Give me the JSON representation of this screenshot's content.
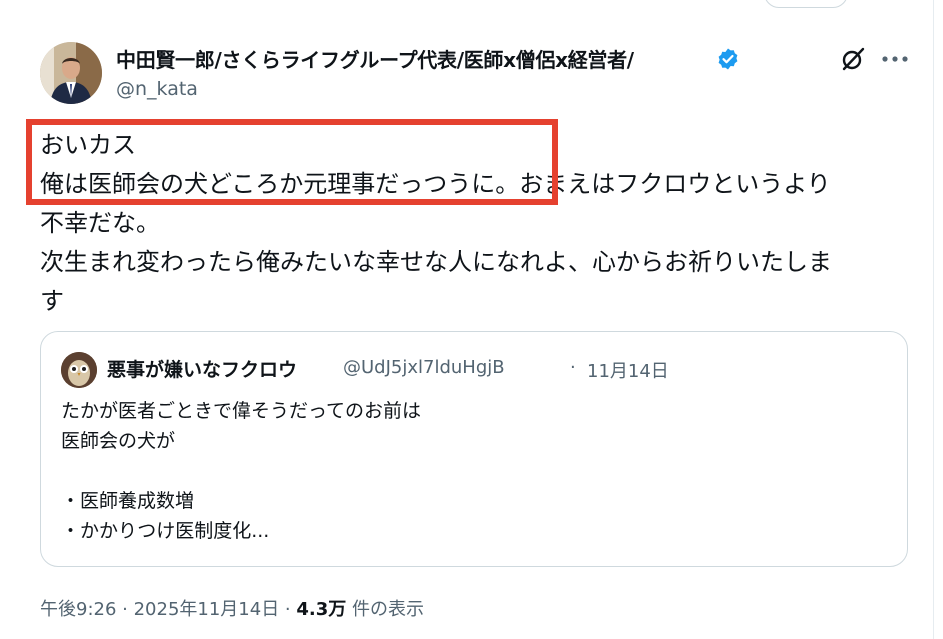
{
  "author": {
    "display_name": "中田賢一郎/さくらライフグループ代表/医師x僧侶x経営者/",
    "handle": "@n_kata",
    "verified": true,
    "avatar_icon": "profile-photo"
  },
  "post": {
    "lines": [
      "おいカス",
      "俺は医師会の犬どころか元理事だっつうに。おまえはフクロウというより",
      "不幸だな。",
      "次生まれ変わったら俺みたいな幸せな人になれよ、心からお祈りいたしま",
      "す"
    ]
  },
  "quoted": {
    "display_name": "悪事が嫌いなフクロウ",
    "handle": "@UdJ5jxl7lduHgjB",
    "separator": "·",
    "date": "11月14日",
    "lines": [
      "たかが医者ごときで偉そうだってのお前は",
      "医師会の犬が",
      "",
      "・医師養成数増",
      "・かかりつけ医制度化..."
    ]
  },
  "meta": {
    "timestamp": "午後9:26 · 2025年11月14日 · ",
    "views_count": "4.3万",
    "views_label": " 件の表示"
  },
  "colors": {
    "highlight": "#e5412f",
    "verified": "#1d9bf0",
    "secondary_text": "#536471",
    "border": "#cfd9de"
  },
  "icons": [
    "verified-badge-icon",
    "grok-icon",
    "more-icon"
  ]
}
